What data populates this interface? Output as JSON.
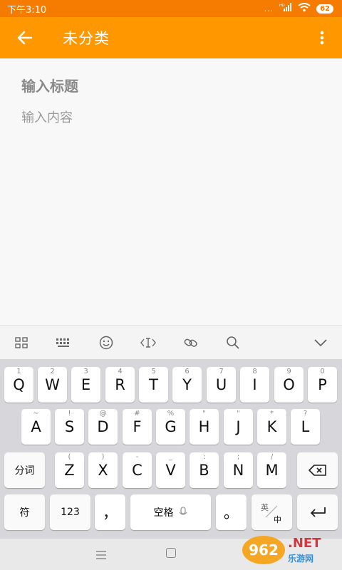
{
  "status_bar": {
    "time": "下午3:10",
    "signal": "...",
    "network": "HD",
    "battery": "62"
  },
  "app_bar": {
    "title": "未分类"
  },
  "editor": {
    "title_placeholder": "输入标题",
    "content_placeholder": "输入内容"
  },
  "keyboard_toolbar": {
    "icons": [
      "grid-icon",
      "keyboard-icon",
      "emoji-icon",
      "cursor-icon",
      "link-icon",
      "search-icon",
      "chevron-down-icon"
    ]
  },
  "keyboard": {
    "row1": [
      {
        "key": "Q",
        "hint": "1"
      },
      {
        "key": "W",
        "hint": "2"
      },
      {
        "key": "E",
        "hint": "3"
      },
      {
        "key": "R",
        "hint": "4"
      },
      {
        "key": "T",
        "hint": "5"
      },
      {
        "key": "Y",
        "hint": "6"
      },
      {
        "key": "U",
        "hint": "7"
      },
      {
        "key": "I",
        "hint": "8"
      },
      {
        "key": "O",
        "hint": "9"
      },
      {
        "key": "P",
        "hint": "0"
      }
    ],
    "row2": [
      {
        "key": "A",
        "hint": "~"
      },
      {
        "key": "S",
        "hint": "!"
      },
      {
        "key": "D",
        "hint": "@"
      },
      {
        "key": "F",
        "hint": "#"
      },
      {
        "key": "G",
        "hint": "%"
      },
      {
        "key": "H",
        "hint": "\""
      },
      {
        "key": "J",
        "hint": "\""
      },
      {
        "key": "K",
        "hint": "*"
      },
      {
        "key": "L",
        "hint": "?"
      }
    ],
    "row3": [
      {
        "key": "Z",
        "hint": "("
      },
      {
        "key": "X",
        "hint": ")"
      },
      {
        "key": "C",
        "hint": "-"
      },
      {
        "key": "V",
        "hint": "_"
      },
      {
        "key": "B",
        "hint": ":"
      },
      {
        "key": "N",
        "hint": ";"
      },
      {
        "key": "M",
        "hint": "/"
      }
    ],
    "split_key": "分词",
    "symbol_key": "符",
    "number_key": "123",
    "comma_key": "，",
    "space_key": "空格",
    "period_key": "。",
    "lang_top": "英",
    "lang_bottom": "中"
  },
  "watermark": {
    "badge": "962",
    "net": ".NET",
    "sub": "乐游网"
  }
}
